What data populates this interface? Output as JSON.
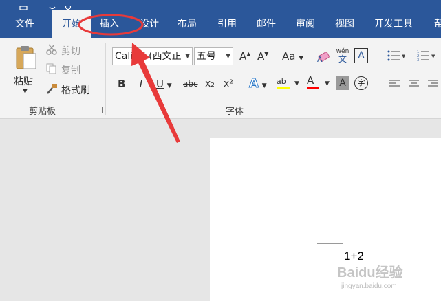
{
  "tabs": [
    "文件",
    "开始",
    "插入",
    "设计",
    "布局",
    "引用",
    "邮件",
    "审阅",
    "视图",
    "开发工具",
    "帮"
  ],
  "clipboard": {
    "paste": "粘贴",
    "cut": "剪切",
    "copy": "复制",
    "format_painter": "格式刷",
    "group_label": "剪贴板"
  },
  "font": {
    "font_name": "Calibri (西文正",
    "font_size": "五号",
    "grow": "A",
    "shrink": "A",
    "change_case": "Aa",
    "phonetic_top": "wén",
    "phonetic_bottom": "文",
    "char_border": "A",
    "bold": "B",
    "italic": "I",
    "underline": "U",
    "strikethrough": "abc",
    "subscript": "x₂",
    "superscript": "x²",
    "text_effects": "A",
    "highlight": "ab",
    "font_color": "A",
    "char_shading": "A",
    "enclose": "字",
    "group_label": "字体"
  },
  "document": {
    "text": "1+2"
  },
  "watermark": {
    "brand": "Baidu经验",
    "url": "jingyan.baidu.com"
  },
  "colors": {
    "accent": "#2b579a",
    "annotation": "#e83a3a",
    "highlight": "#ffff00",
    "font_color": "#ff0000"
  },
  "icons": [
    "paste-icon",
    "cut-icon",
    "copy-icon",
    "format-painter-icon",
    "clear-format-icon",
    "bullets-icon",
    "numbering-icon"
  ]
}
